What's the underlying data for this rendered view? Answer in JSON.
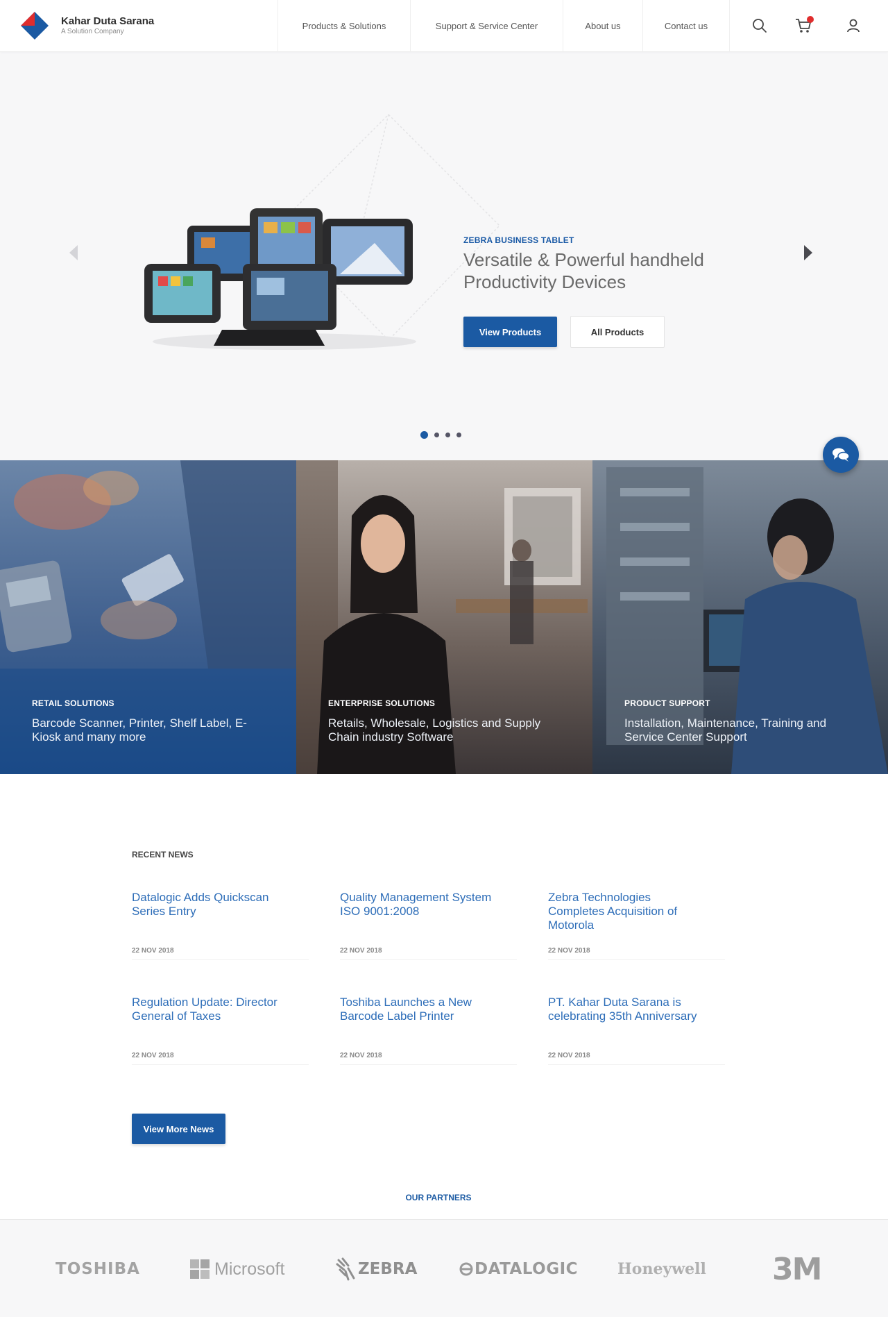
{
  "brand": {
    "name": "Kahar Duta Sarana",
    "tagline": "A Solution Company"
  },
  "nav": {
    "products": "Products & Solutions",
    "support": "Support & Service Center",
    "about": "About us",
    "contact": "Contact us"
  },
  "header_icons": [
    "search-icon",
    "cart-icon",
    "user-icon"
  ],
  "hero": {
    "eyebrow": "ZEBRA BUSINESS TABLET",
    "title": "Versatile & Powerful handheld Productivity Devices",
    "primary_button": "View Products",
    "secondary_button": "All Products",
    "slide_count": 4,
    "active_slide": 1
  },
  "solutions": [
    {
      "title": "RETAIL SOLUTIONS",
      "description": "Barcode Scanner, Printer, Shelf Label, E-Kiosk and many more"
    },
    {
      "title": "ENTERPRISE SOLUTIONS",
      "description": "Retails, Wholesale, Logistics and Supply Chain industry Software"
    },
    {
      "title": "PRODUCT SUPPORT",
      "description": "Installation, Maintenance, Training and Service Center Support"
    }
  ],
  "news": {
    "heading": "RECENT NEWS",
    "items": [
      {
        "title": "Datalogic Adds Quickscan Series Entry",
        "date": "22 NOV 2018"
      },
      {
        "title": "Quality Management System ISO 9001:2008",
        "date": "22 NOV 2018"
      },
      {
        "title": "Zebra Technologies Completes Acquisition of Motorola",
        "date": "22 NOV 2018"
      },
      {
        "title": "Regulation Update: Director General of Taxes",
        "date": "22 NOV 2018"
      },
      {
        "title": "Toshiba Launches a New Barcode Label Printer",
        "date": "22 NOV 2018"
      },
      {
        "title": "PT. Kahar Duta Sarana is celebrating 35th Anniversary",
        "date": "22 NOV 2018"
      }
    ],
    "more_button": "View More News"
  },
  "partners": {
    "heading": "OUR PARTNERS",
    "logos": [
      "TOSHIBA",
      "Microsoft",
      "ZEBRA",
      "DATALOGIC",
      "Honeywell",
      "3M"
    ]
  },
  "colors": {
    "brand_blue": "#1b5aa3",
    "brand_red": "#e02d2d",
    "link_blue": "#2d6db8"
  }
}
